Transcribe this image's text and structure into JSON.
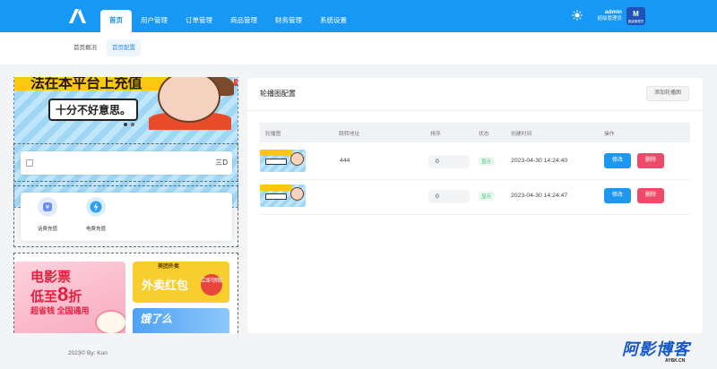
{
  "nav": {
    "items": [
      {
        "label": "首页",
        "active": true
      },
      {
        "label": "用户管理",
        "active": false
      },
      {
        "label": "订单管理",
        "active": false
      },
      {
        "label": "商品管理",
        "active": false
      },
      {
        "label": "财务管理",
        "active": false
      },
      {
        "label": "系统设置",
        "active": false
      }
    ],
    "user_name": "admin",
    "user_role": "超级管理员",
    "avatar_sub": "超级管理员"
  },
  "subnav": {
    "tabs": [
      {
        "label": "首页概况",
        "active": false
      },
      {
        "label": "首页配置",
        "active": true
      }
    ]
  },
  "preview": {
    "banner_title": "法在本平台上充值",
    "banner_pill": "十分不好意思。",
    "notice_tail": "三D",
    "icons": [
      {
        "label": "话费充值",
        "icon": "phone-recharge-icon",
        "color": "#6b8cf0"
      },
      {
        "label": "电费充值",
        "icon": "electric-recharge-icon",
        "color": "#2f9ef5"
      }
    ],
    "movie_line1": "电影票",
    "movie_line2_pre": "低至",
    "movie_line2_num": "8",
    "movie_line2_post": "折",
    "movie_line3": "超省钱 全国通用",
    "food_brand": "美团外卖",
    "food_title": "外卖红包",
    "food_badge": "立即领取",
    "ele_title": "饿了么"
  },
  "carousel": {
    "title": "轮播图配置",
    "add_button": "添加轮播图",
    "columns": [
      "轮播图",
      "跳转地址",
      "排序",
      "状态",
      "创建时间",
      "操作"
    ],
    "rows": [
      {
        "url": "444",
        "sort": "0",
        "status": "显示",
        "created": "2023-04-30 14:24:40",
        "edit": "修改",
        "delete": "删除"
      },
      {
        "url": "",
        "sort": "0",
        "status": "显示",
        "created": "2023-04-30 14:24:47",
        "edit": "修改",
        "delete": "删除"
      }
    ]
  },
  "footer": "2023© By: Kun",
  "watermark": {
    "main": "阿影博客",
    "sub": "AYBK.CN"
  }
}
